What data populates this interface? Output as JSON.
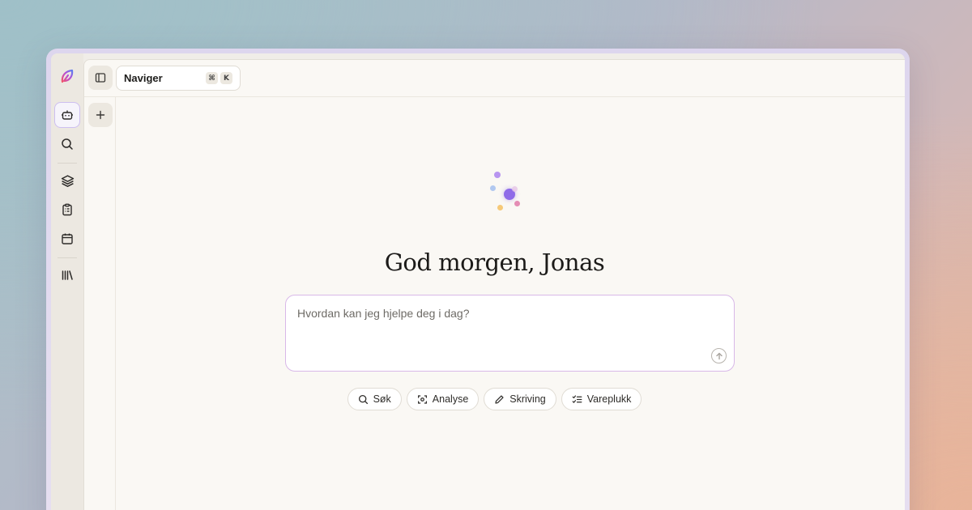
{
  "app": {
    "logo": "leaf-logo-icon",
    "brand_color": "#e94e7f"
  },
  "rail": {
    "items": [
      {
        "name": "assistant",
        "icon": "robot-icon",
        "active": true
      },
      {
        "name": "search",
        "icon": "search-icon"
      },
      {
        "name": "layers",
        "icon": "layers-icon"
      },
      {
        "name": "tasks",
        "icon": "clipboard-list-icon"
      },
      {
        "name": "calendar",
        "icon": "calendar-icon"
      },
      {
        "name": "library",
        "icon": "library-icon"
      }
    ]
  },
  "toolbar": {
    "toggle_sidebar_icon": "sidebar-toggle-icon",
    "navigate_label": "Naviger",
    "shortcut_keys": [
      "⌘",
      "K"
    ],
    "new_icon": "plus-icon"
  },
  "main": {
    "greeting": "God morgen, Jonas",
    "prompt_placeholder": "Hvordan kan jeg hjelpe deg i dag?",
    "send_icon": "arrow-up-icon",
    "chips": [
      {
        "label": "Søk",
        "icon": "search-icon"
      },
      {
        "label": "Analyse",
        "icon": "scan-icon"
      },
      {
        "label": "Skriving",
        "icon": "pencil-icon"
      },
      {
        "label": "Vareplukk",
        "icon": "checklist-icon"
      }
    ]
  },
  "colors": {
    "accent": "#8b5cf6",
    "prompt_border": "#d8b8e8"
  }
}
